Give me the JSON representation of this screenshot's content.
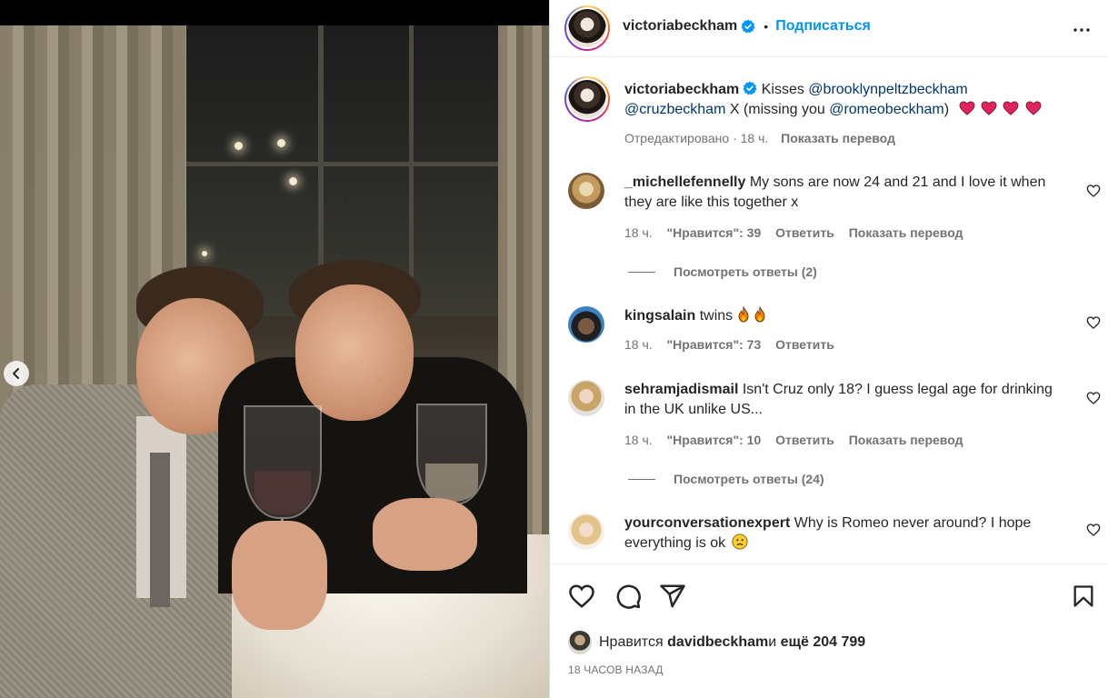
{
  "post": {
    "author": "victoriabeckham",
    "follow_label": "Подписаться",
    "separator": "•",
    "caption_author": "victoriabeckham",
    "caption_text_1": " Kisses ",
    "mention_1": "@brooklynpeltzbeckham",
    "mention_2": "@cruzbeckham",
    "caption_text_2": " X (missing you ",
    "mention_3": "@romeobeckham",
    "caption_text_3": ")",
    "caption_meta_edited": "Отредактировано · 18 ч.",
    "caption_meta_translate": "Показать перевод"
  },
  "comments": [
    {
      "user": "_michellefennelly",
      "text": " My sons are now 24 and 21 and I love it when they are like this together x",
      "time": "18 ч.",
      "likes": "\"Нравится\": 39",
      "reply": "Ответить",
      "translate": "Показать перевод",
      "view_replies": "Посмотреть ответы (2)"
    },
    {
      "user": "kingsalain",
      "text": " twins",
      "time": "18 ч.",
      "likes": "\"Нравится\": 73",
      "reply": "Ответить"
    },
    {
      "user": "sehramjadismail",
      "text": " Isn't Cruz only 18? I guess legal age for drinking in the UK unlike US...",
      "time": "18 ч.",
      "likes": "\"Нравится\": 10",
      "reply": "Ответить",
      "translate": "Показать перевод",
      "view_replies": "Посмотреть ответы (24)"
    },
    {
      "user": "yourconversationexpert",
      "text": " Why is Romeo never around? I hope everything is ok"
    }
  ],
  "footer": {
    "likes_prefix": "Нравится ",
    "likes_user": "davidbeckham",
    "likes_mid": " и ",
    "likes_count": "ещё 204 799",
    "timestamp": "18 ЧАСОВ НАЗАД"
  },
  "icons": {
    "verified": "verified-badge-icon",
    "more": "more-options-icon",
    "like": "heart-icon",
    "comment": "comment-icon",
    "share": "share-icon",
    "save": "bookmark-icon",
    "prev": "chevron-left-icon"
  },
  "colors": {
    "link_blue": "#0095f6",
    "mention": "#00376b",
    "muted": "#737373",
    "heart_red": "#e0245e"
  }
}
